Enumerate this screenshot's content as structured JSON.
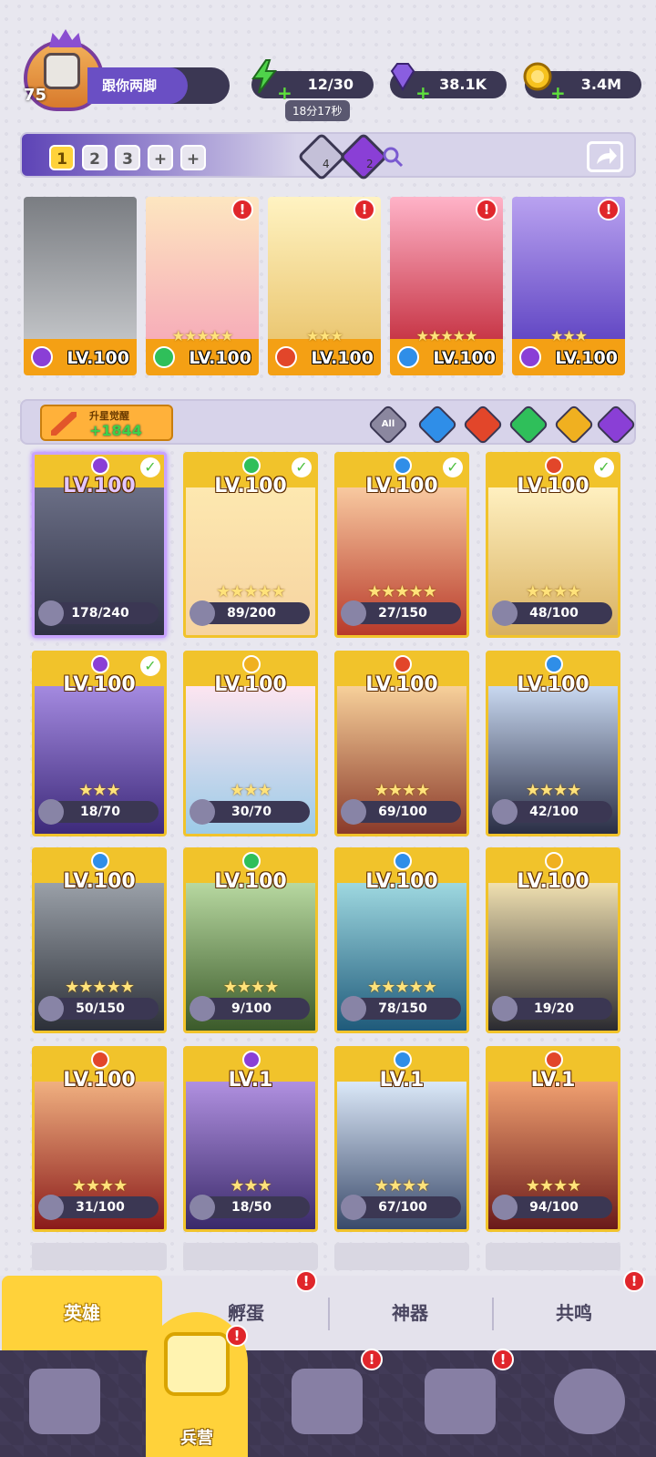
{
  "player": {
    "level": "75",
    "name": "跟你两脚"
  },
  "resources": {
    "energy": "12/30",
    "energy_timer": "18分17秒",
    "gems": "38.1K",
    "gold": "3.4M"
  },
  "team": {
    "tabs": [
      "1",
      "2",
      "3",
      "+",
      "+"
    ],
    "active_tab": "1",
    "crystal_a_count": "4",
    "crystal_b_count": "2"
  },
  "slots": [
    {
      "level": "LV.100",
      "stars": "",
      "element": "dark",
      "alert": false
    },
    {
      "level": "LV.100",
      "stars": "★★★★★",
      "element": "wind",
      "alert": true
    },
    {
      "level": "LV.100",
      "stars": "★★★",
      "element": "fire",
      "alert": true
    },
    {
      "level": "LV.100",
      "stars": "★★★★★",
      "element": "water",
      "alert": true
    },
    {
      "level": "LV.100",
      "stars": "★★★",
      "element": "dark",
      "alert": true
    }
  ],
  "awaken": {
    "label": "升星觉醒",
    "value": "+1844"
  },
  "filters": [
    "All",
    "water",
    "fire",
    "wind",
    "light",
    "dark"
  ],
  "filter_all_label": "All",
  "cards": [
    {
      "level": "LV.100",
      "stars": "",
      "frag": "178/240",
      "element": "dark",
      "check": true
    },
    {
      "level": "LV.100",
      "stars": "★★★★★",
      "frag": "89/200",
      "element": "wind",
      "check": true
    },
    {
      "level": "LV.100",
      "stars": "★★★★★",
      "frag": "27/150",
      "element": "water",
      "check": true
    },
    {
      "level": "LV.100",
      "stars": "★★★★",
      "frag": "48/100",
      "element": "fire",
      "check": true
    },
    {
      "level": "LV.100",
      "stars": "★★★",
      "frag": "18/70",
      "element": "dark",
      "check": true
    },
    {
      "level": "LV.100",
      "stars": "★★★",
      "frag": "30/70",
      "element": "light",
      "check": false
    },
    {
      "level": "LV.100",
      "stars": "★★★★",
      "frag": "69/100",
      "element": "fire",
      "check": false
    },
    {
      "level": "LV.100",
      "stars": "★★★★",
      "frag": "42/100",
      "element": "water",
      "check": false
    },
    {
      "level": "LV.100",
      "stars": "★★★★★",
      "frag": "50/150",
      "element": "water",
      "check": false
    },
    {
      "level": "LV.100",
      "stars": "★★★★",
      "frag": "9/100",
      "element": "wind",
      "check": false
    },
    {
      "level": "LV.100",
      "stars": "★★★★★",
      "frag": "78/150",
      "element": "water",
      "check": false
    },
    {
      "level": "LV.100",
      "stars": "",
      "frag": "19/20",
      "element": "light",
      "check": false
    },
    {
      "level": "LV.100",
      "stars": "★★★★",
      "frag": "31/100",
      "element": "fire",
      "check": false
    },
    {
      "level": "LV.1",
      "stars": "★★★",
      "frag": "18/50",
      "element": "dark",
      "check": false
    },
    {
      "level": "LV.1",
      "stars": "★★★★",
      "frag": "67/100",
      "element": "water",
      "check": false
    },
    {
      "level": "LV.1",
      "stars": "★★★★",
      "frag": "94/100",
      "element": "fire",
      "check": false
    }
  ],
  "subtabs": [
    "英雄",
    "孵蛋",
    "神器",
    "共鸣"
  ],
  "nav": {
    "active_label": "兵营"
  },
  "colors": {
    "fire": "#e2462a",
    "water": "#2f8ee8",
    "wind": "#2fbf5a",
    "light": "#f0b020",
    "dark": "#8a3fd6",
    "gold": "#f1c32b"
  }
}
